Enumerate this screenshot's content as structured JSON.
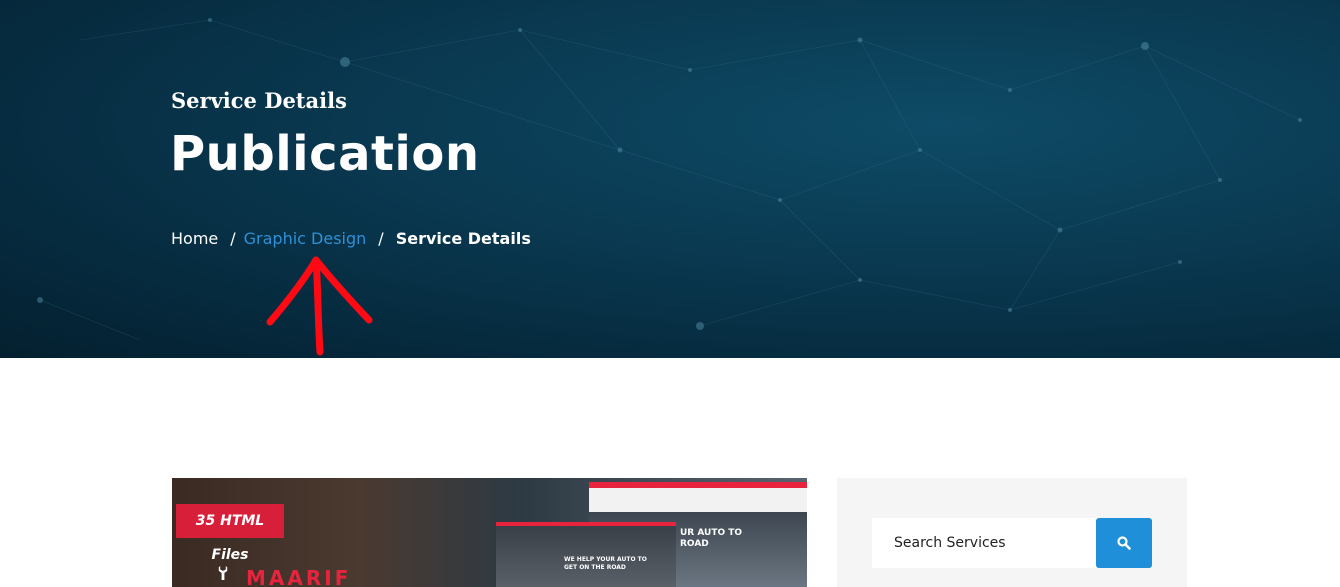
{
  "hero": {
    "subtitle": "Service Details",
    "title": "Publication",
    "breadcrumb": {
      "home": "Home",
      "separator": "/",
      "category": "Graphic Design",
      "current": "Service Details"
    },
    "annotation_icon": "red-arrow-up-icon"
  },
  "content": {
    "image": {
      "badge": "35 HTML Files",
      "brand": "MAARIF",
      "screenshot_text_1": "UR AUTO TO\nROAD",
      "screenshot_text_2": "WE HELP YOUR AUTO TO\nGET ON THE ROAD"
    }
  },
  "sidebar": {
    "search": {
      "placeholder": "Search Services",
      "button_icon": "search-icon"
    }
  },
  "colors": {
    "hero_bg": "#0a3a52",
    "link_accent": "#2e90d6",
    "search_button": "#1e8fd8",
    "badge_red": "#d81f3a",
    "annotation_red": "#ff0a14"
  }
}
